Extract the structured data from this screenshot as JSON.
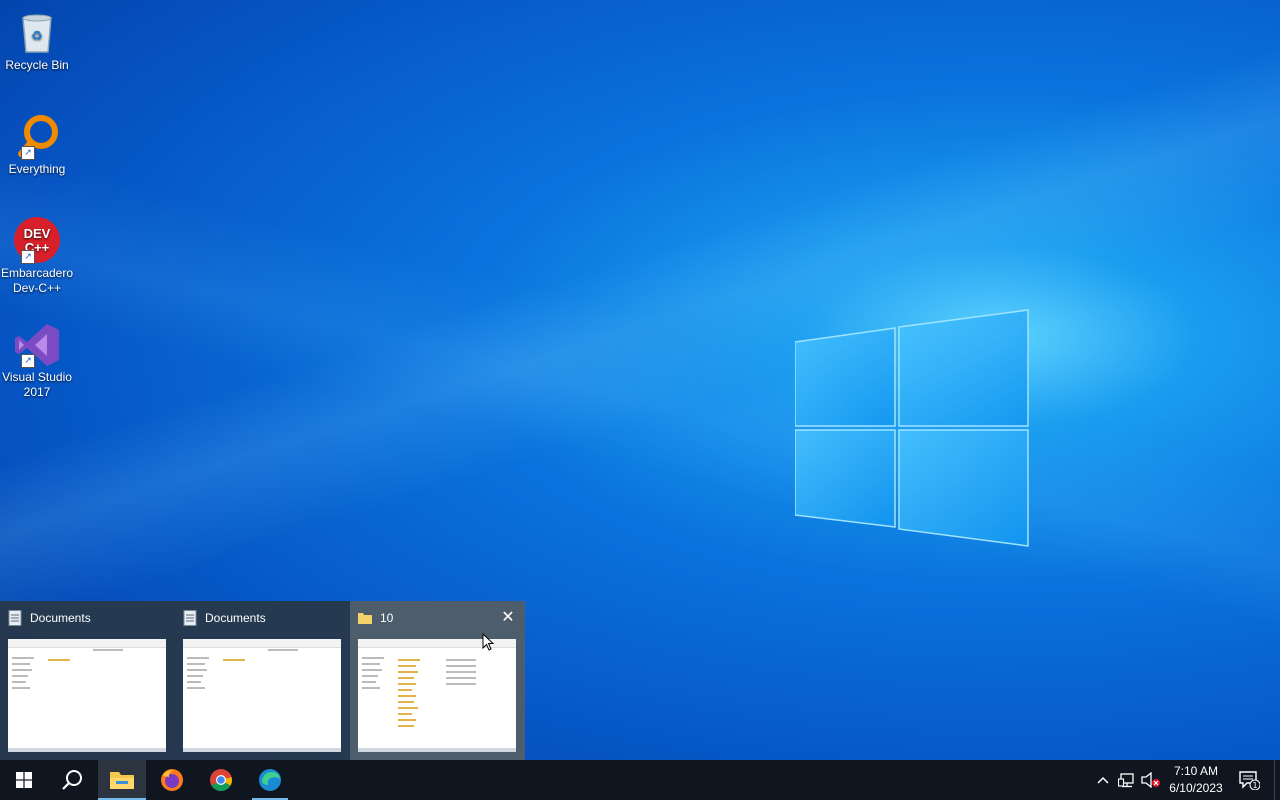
{
  "desktop": {
    "icons": [
      {
        "label": "Recycle Bin"
      },
      {
        "label": "Everything"
      },
      {
        "label_line1": "Embarcadero",
        "label_line2": "Dev-C++",
        "icon_text_top": "DEV",
        "icon_text_bottom": "C++"
      },
      {
        "label_line1": "Visual Studio",
        "label_line2": "2017"
      }
    ]
  },
  "thumbnails": [
    {
      "title": "Documents",
      "icon": "document-icon"
    },
    {
      "title": "Documents",
      "icon": "document-icon"
    },
    {
      "title": "10",
      "icon": "folder-icon",
      "close_label": "✕"
    }
  ],
  "taskbar": {
    "buttons": [
      "start-icon",
      "search-icon",
      "file-explorer-icon",
      "firefox-icon",
      "chrome-icon",
      "edge-icon"
    ],
    "tray": [
      "chevron-up-icon",
      "network-icon",
      "volume-muted-icon"
    ],
    "time": "7:10 AM",
    "date": "6/10/2023",
    "notification_count": "1"
  },
  "colors": {
    "taskbar": "#10161f",
    "accent": "#76b9ed",
    "desktop_blue": "#0a73dd"
  }
}
